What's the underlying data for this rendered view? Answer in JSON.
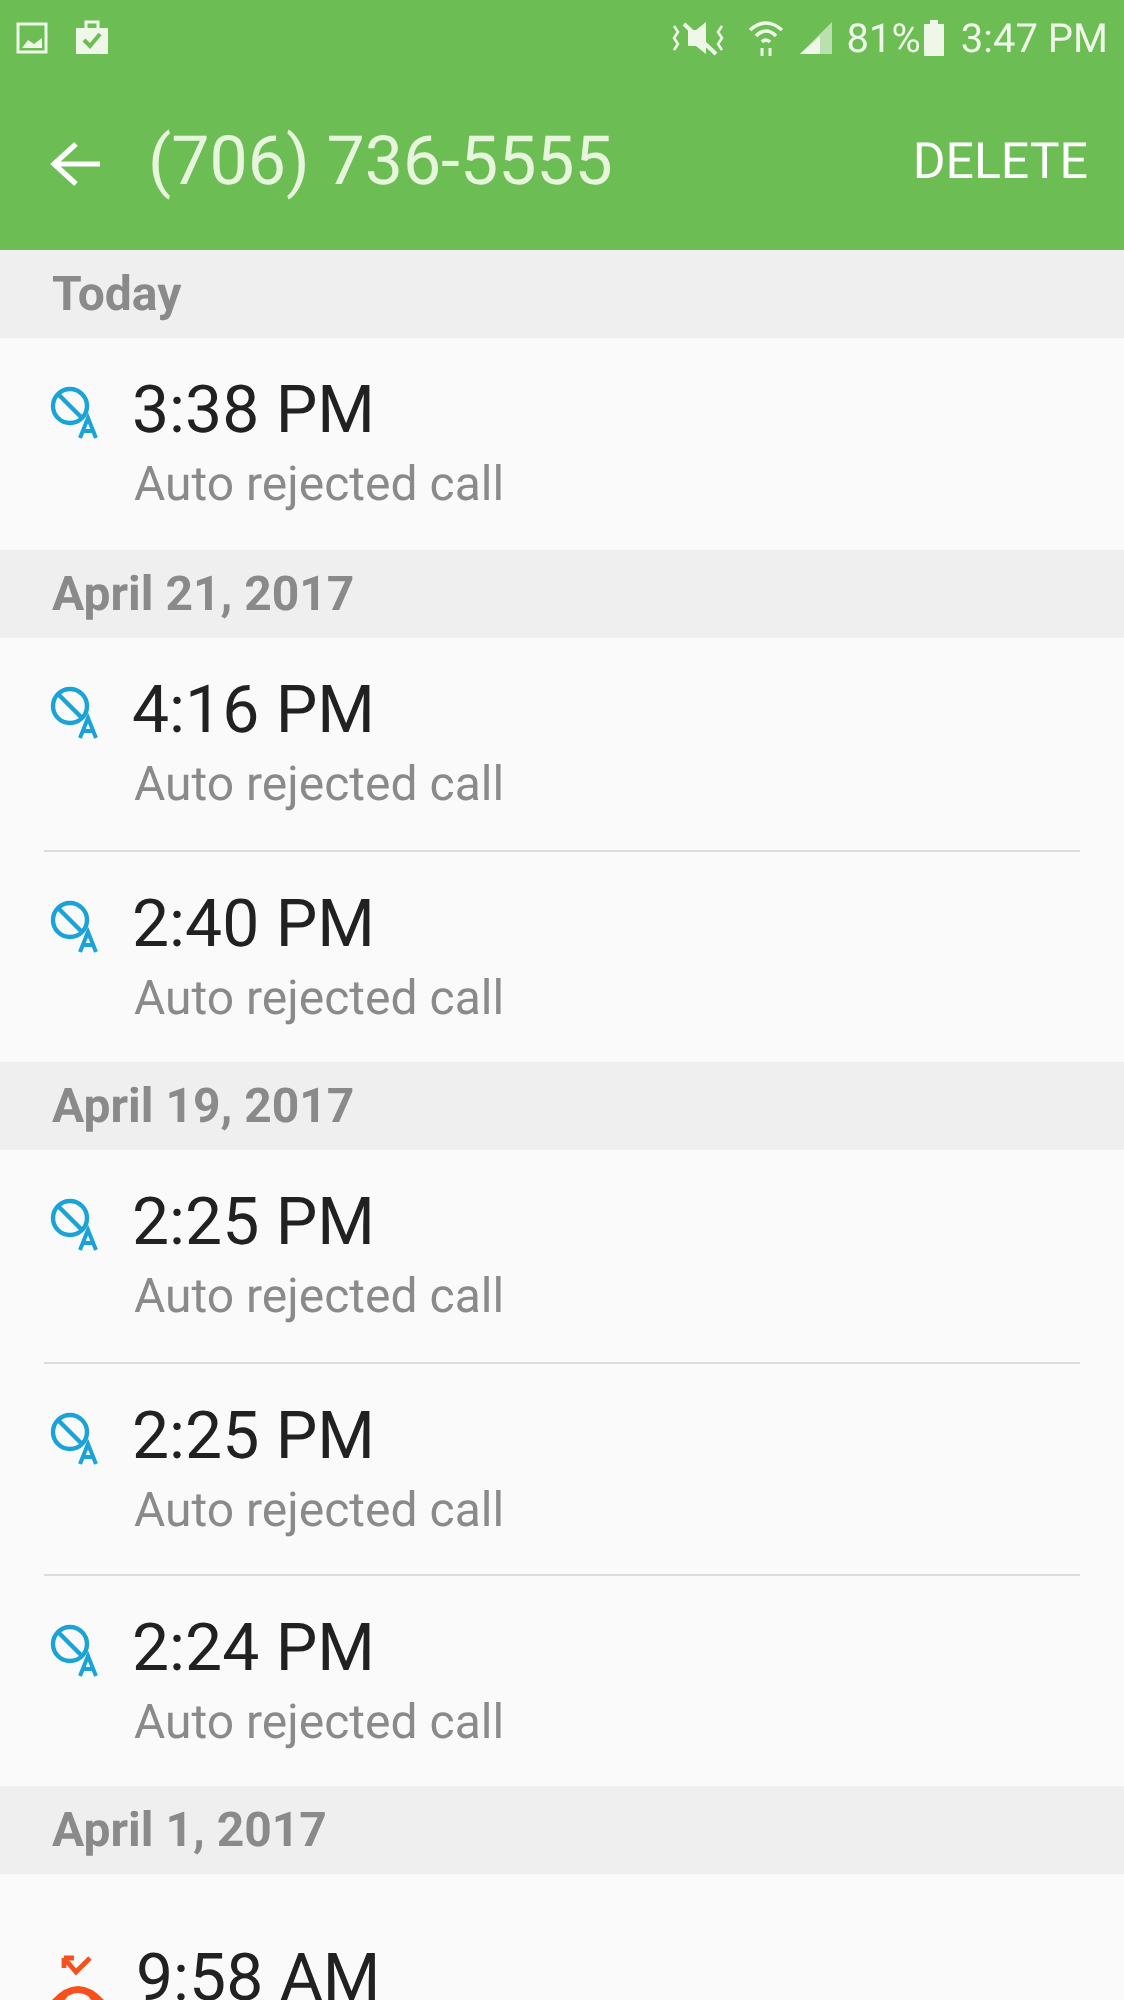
{
  "status_bar": {
    "battery": "81%",
    "time": "3:47 PM"
  },
  "app_bar": {
    "title": "(706) 736-5555",
    "action": "DELETE"
  },
  "sections": [
    {
      "date": "Today",
      "calls": [
        {
          "kind": "auto_rejected",
          "time": "3:38 PM",
          "detail": "Auto rejected call"
        }
      ]
    },
    {
      "date": "April 21, 2017",
      "calls": [
        {
          "kind": "auto_rejected",
          "time": "4:16 PM",
          "detail": "Auto rejected call"
        },
        {
          "kind": "auto_rejected",
          "time": "2:40 PM",
          "detail": "Auto rejected call"
        }
      ]
    },
    {
      "date": "April 19, 2017",
      "calls": [
        {
          "kind": "auto_rejected",
          "time": "2:25 PM",
          "detail": "Auto rejected call"
        },
        {
          "kind": "auto_rejected",
          "time": "2:25 PM",
          "detail": "Auto rejected call"
        },
        {
          "kind": "auto_rejected",
          "time": "2:24 PM",
          "detail": "Auto rejected call"
        }
      ]
    },
    {
      "date": "April 1, 2017",
      "calls": [
        {
          "kind": "rejected",
          "time": "9:58 AM"
        }
      ]
    }
  ]
}
